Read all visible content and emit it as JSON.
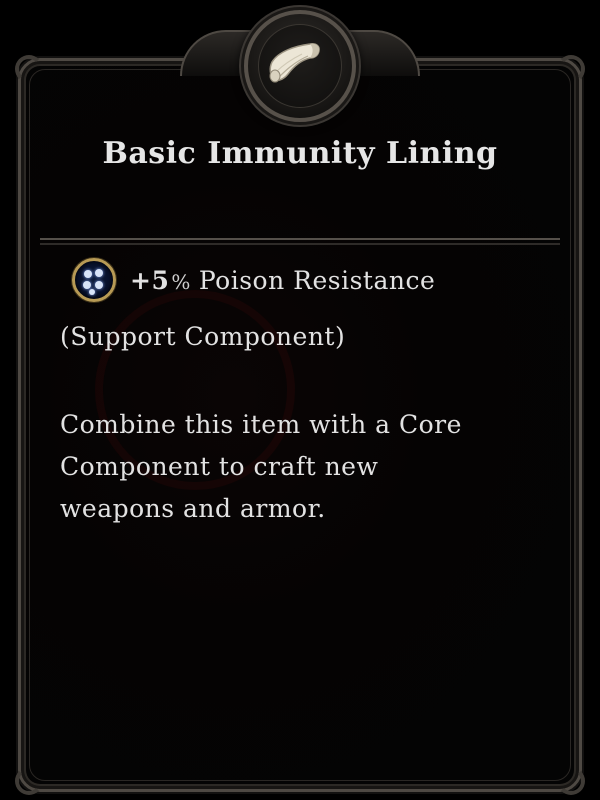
{
  "item": {
    "icon": "scroll-icon",
    "title": "Basic Immunity Lining",
    "stat": {
      "icon": "resistance-orb-icon",
      "value": "+5",
      "unit": "%",
      "label": "Poison Resistance"
    },
    "component_type": "(Support Component)",
    "description_lines": [
      "Combine this item with a Core",
      "Component to craft new",
      "weapons and armor."
    ]
  },
  "colors": {
    "background": "#000000",
    "frame": "#4e4943",
    "text": "#e2e2e2",
    "orb_rim": "#b79a55"
  }
}
